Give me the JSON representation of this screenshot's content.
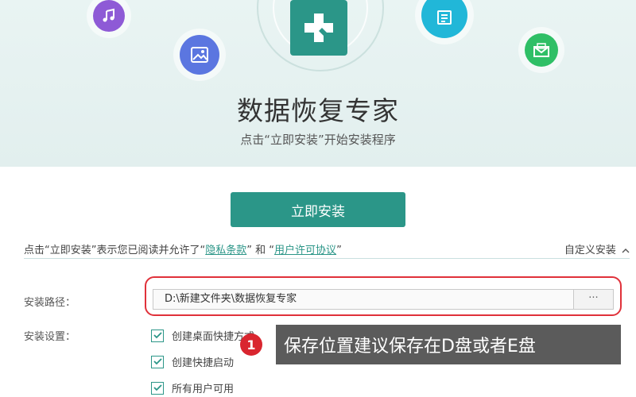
{
  "app": {
    "title": "数据恢复专家",
    "subtitle": "点击“立即安装”开始安装程序"
  },
  "install_button": {
    "label": "立即安装"
  },
  "agreement": {
    "prefix": "点击“立即安装”表示您已阅读并允许了",
    "quote_open": "“",
    "privacy_link": "隐私条款",
    "quote_close": "”",
    "and": "和",
    "license_link": "用户许可协议"
  },
  "custom_install": {
    "label": "自定义安装"
  },
  "install_path": {
    "label": "安装路径：",
    "value": "D:\\新建文件夹\\数据恢复专家",
    "browse_label": "···"
  },
  "settings": {
    "label": "安装设置：",
    "options": [
      {
        "label": "创建桌面快捷方式",
        "checked": true
      },
      {
        "label": "创建快捷启动",
        "checked": true
      },
      {
        "label": "所有用户可用",
        "checked": true
      }
    ]
  },
  "annotation": {
    "number": "1",
    "text": "保存位置建议保存在D盘或者E盘"
  },
  "colors": {
    "accent": "#2b9688",
    "highlight": "#e0313a",
    "music_icon_bg": "#8e5ad6",
    "image_icon_bg": "#5b76e0",
    "doc_icon_bg": "#21b7d8",
    "mail_icon_bg": "#2fbf66"
  }
}
